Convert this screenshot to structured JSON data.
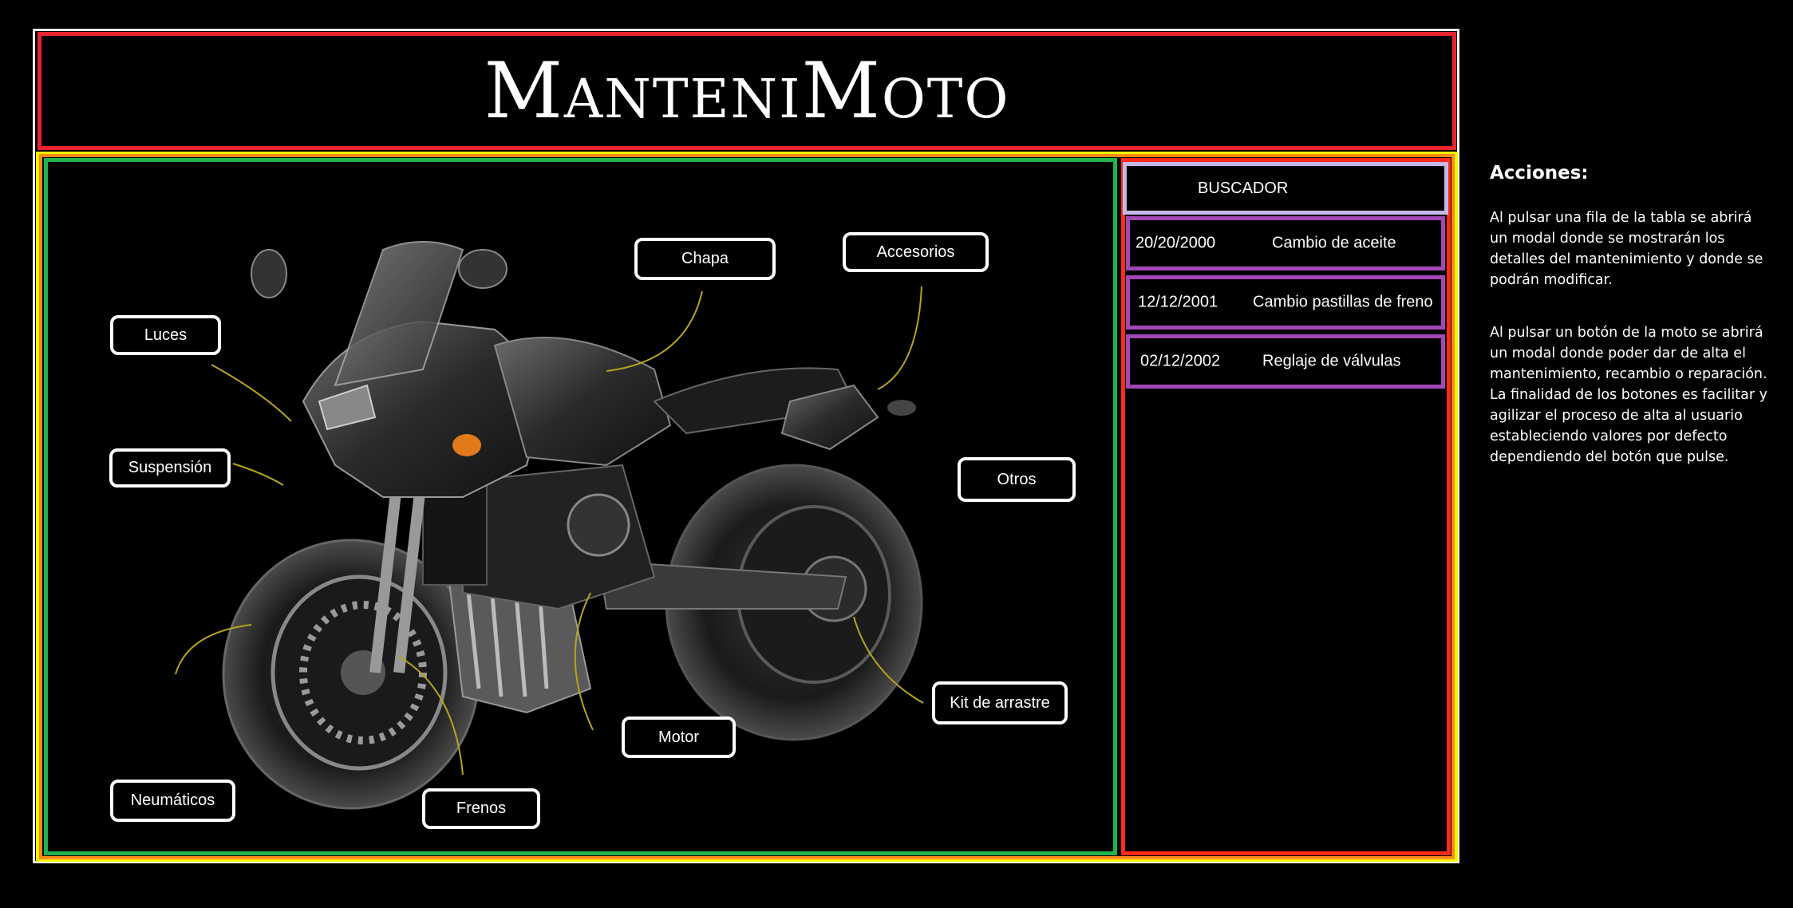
{
  "app": {
    "title": "ManteniMoto"
  },
  "moto_buttons": {
    "luces": "Luces",
    "suspension": "Suspensión",
    "neumaticos": "Neumáticos",
    "frenos": "Frenos",
    "motor": "Motor",
    "chapa": "Chapa",
    "accesorios": "Accesorios",
    "otros": "Otros",
    "kit_arrastre": "Kit de arrastre"
  },
  "search": {
    "label": "BUSCADOR"
  },
  "table": {
    "rows": [
      {
        "date": "20/20/2000",
        "description": "Cambio de aceite"
      },
      {
        "date": "12/12/2001",
        "description": "Cambio pastillas de freno"
      },
      {
        "date": "02/12/2002",
        "description": "Reglaje de válvulas"
      }
    ]
  },
  "notes": {
    "heading": "Acciones:",
    "paragraph_1": "Al pulsar una fila de la tabla se abrirá un modal donde se mostrarán los detalles del mantenimiento y donde se podrán modificar.",
    "paragraph_2": "Al pulsar un botón de la moto se abrirá un modal donde poder dar de alta el mantenimiento, recambio o reparación. La finalidad de los botones es facilitar y agilizar el proceso de alta al usuario estableciendo valores por defecto dependiendo del botón que pulse."
  },
  "colors": {
    "background": "#000000",
    "header_border": "#e8242e",
    "moto_border": "#22b24c",
    "side_border": "#ff2a18",
    "outer_yellow": "#f4f400",
    "outer_orange": "#ff8a12",
    "search_border": "#c7b7e8",
    "row_border": "#a347b7",
    "arrow": "#b5a51a"
  }
}
